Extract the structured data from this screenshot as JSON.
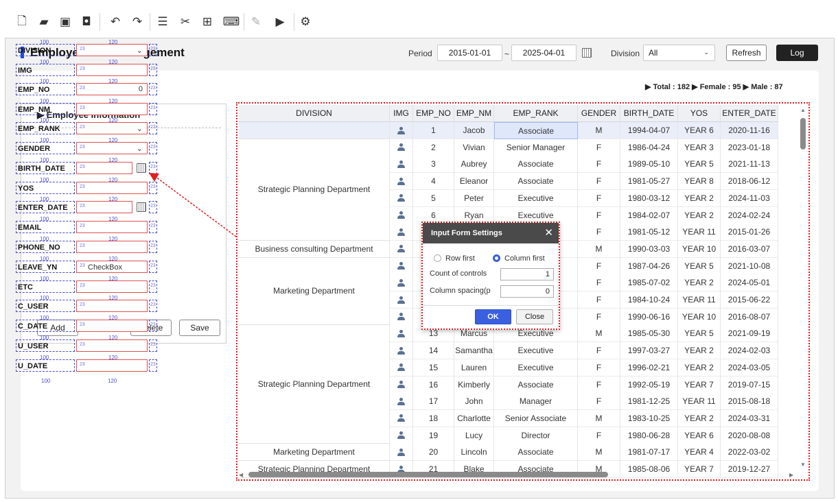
{
  "toolbar": {
    "icons": [
      "new-file",
      "open-folder",
      "save",
      "save-all",
      "undo",
      "redo",
      "database",
      "tools",
      "hierarchy",
      "code-view",
      "edit",
      "run",
      "settings"
    ]
  },
  "header": {
    "title": "Employee Info Management",
    "period_label": "Period",
    "date_from": "2015-01-01",
    "tilde": "~",
    "date_to": "2025-04-01",
    "division_label": "Division",
    "division_value": "All",
    "refresh_label": "Refresh",
    "log_label": "Log"
  },
  "stats": {
    "total": "▶ Total : 182",
    "female": "▶ Female : 95",
    "male": "▶ Male : 87"
  },
  "employee_panel": {
    "title": "▶ Employee Information",
    "add_label": "Add",
    "delete_label": "Delete",
    "save_label": "Save"
  },
  "layout_fields": {
    "label_width": "100",
    "control_width": "120",
    "checkbox_text": "CheckBox",
    "zero": "0",
    "glyph": "23",
    "labels": [
      "DIVISION",
      "IMG",
      "EMP_NO",
      "EMP_NM",
      "EMP_RANK",
      "GENDER",
      "BIRTH_DATE",
      "YOS",
      "ENTER_DATE",
      "EMAIL",
      "PHONE_NO",
      "LEAVE_YN",
      "ETC",
      "C_USER",
      "C_DATE",
      "U_USER",
      "U_DATE"
    ]
  },
  "grid": {
    "columns": [
      "DIVISION",
      "IMG",
      "EMP_NO",
      "EMP_NM",
      "EMP_RANK",
      "GENDER",
      "BIRTH_DATE",
      "YOS",
      "ENTER_DATE"
    ],
    "division_groups": [
      {
        "text": "",
        "rows": 1
      },
      {
        "text": "Strategic Planning Department",
        "rows": 6
      },
      {
        "text": "Business consulting Department",
        "rows": 1
      },
      {
        "text": "Marketing Department",
        "rows": 4
      },
      {
        "text": "Strategic Planning Department",
        "rows": 7
      },
      {
        "text": "Marketing Department",
        "rows": 1
      },
      {
        "text": "Strategic Planning Department",
        "rows": 1
      },
      {
        "text": "Marketing Department",
        "rows": 1
      }
    ],
    "rows": [
      {
        "no": "1",
        "nm": "Jacob",
        "rank": "Associate",
        "gender": "M",
        "birth": "1994-04-07",
        "yos": "YEAR 6",
        "enter": "2020-11-16"
      },
      {
        "no": "2",
        "nm": "Vivian",
        "rank": "Senior Manager",
        "gender": "F",
        "birth": "1986-04-24",
        "yos": "YEAR 3",
        "enter": "2023-01-18"
      },
      {
        "no": "3",
        "nm": "Aubrey",
        "rank": "Associate",
        "gender": "F",
        "birth": "1989-05-10",
        "yos": "YEAR 5",
        "enter": "2021-11-13"
      },
      {
        "no": "4",
        "nm": "Eleanor",
        "rank": "Associate",
        "gender": "F",
        "birth": "1981-05-27",
        "yos": "YEAR 8",
        "enter": "2018-06-12"
      },
      {
        "no": "5",
        "nm": "Peter",
        "rank": "Executive",
        "gender": "F",
        "birth": "1980-03-12",
        "yos": "YEAR 2",
        "enter": "2024-11-03"
      },
      {
        "no": "6",
        "nm": "Ryan",
        "rank": "Executive",
        "gender": "F",
        "birth": "1984-02-07",
        "yos": "YEAR 2",
        "enter": "2024-02-24"
      },
      {
        "no": "7",
        "nm": "",
        "rank": "",
        "gender": "F",
        "birth": "1981-05-12",
        "yos": "YEAR 11",
        "enter": "2015-01-26"
      },
      {
        "no": "8",
        "nm": "",
        "rank": "ager",
        "gender": "M",
        "birth": "1990-03-03",
        "yos": "YEAR 10",
        "enter": "2016-03-07"
      },
      {
        "no": "9",
        "nm": "",
        "rank": "e",
        "gender": "F",
        "birth": "1987-04-26",
        "yos": "YEAR 5",
        "enter": "2021-10-08"
      },
      {
        "no": "10",
        "nm": "",
        "rank": "ciate",
        "gender": "F",
        "birth": "1985-07-02",
        "yos": "YEAR 2",
        "enter": "2024-05-01"
      },
      {
        "no": "11",
        "nm": "",
        "rank": "e",
        "gender": "F",
        "birth": "1984-10-24",
        "yos": "YEAR 11",
        "enter": "2015-06-22"
      },
      {
        "no": "12",
        "nm": "",
        "rank": "ager",
        "gender": "F",
        "birth": "1990-06-16",
        "yos": "YEAR 10",
        "enter": "2016-08-07"
      },
      {
        "no": "13",
        "nm": "Marcus",
        "rank": "Executive",
        "gender": "M",
        "birth": "1985-05-30",
        "yos": "YEAR 5",
        "enter": "2021-09-19"
      },
      {
        "no": "14",
        "nm": "Samantha",
        "rank": "Executive",
        "gender": "F",
        "birth": "1997-03-27",
        "yos": "YEAR 2",
        "enter": "2024-02-03"
      },
      {
        "no": "15",
        "nm": "Lauren",
        "rank": "Executive",
        "gender": "F",
        "birth": "1996-02-21",
        "yos": "YEAR 2",
        "enter": "2024-03-05"
      },
      {
        "no": "16",
        "nm": "Kimberly",
        "rank": "Associate",
        "gender": "F",
        "birth": "1992-05-19",
        "yos": "YEAR 7",
        "enter": "2019-07-15"
      },
      {
        "no": "17",
        "nm": "John",
        "rank": "Manager",
        "gender": "F",
        "birth": "1981-12-25",
        "yos": "YEAR 11",
        "enter": "2015-08-18"
      },
      {
        "no": "18",
        "nm": "Charlotte",
        "rank": "Senior Associate",
        "gender": "M",
        "birth": "1983-10-25",
        "yos": "YEAR 2",
        "enter": "2024-03-31"
      },
      {
        "no": "19",
        "nm": "Lucy",
        "rank": "Director",
        "gender": "F",
        "birth": "1980-06-28",
        "yos": "YEAR 6",
        "enter": "2020-08-08"
      },
      {
        "no": "20",
        "nm": "Lincoln",
        "rank": "Associate",
        "gender": "M",
        "birth": "1981-07-17",
        "yos": "YEAR 4",
        "enter": "2022-03-02"
      },
      {
        "no": "21",
        "nm": "Blake",
        "rank": "Associate",
        "gender": "M",
        "birth": "1985-08-06",
        "yos": "YEAR 7",
        "enter": "2019-12-27"
      }
    ]
  },
  "dialog": {
    "title": "Input Form Settings",
    "close_symbol": "✕",
    "row_first": "Row first",
    "column_first": "Column first",
    "count_label": "Count of controls",
    "count_value": "1",
    "spacing_label": "Column spacing(p",
    "spacing_value": "0",
    "ok_label": "OK",
    "close_label": "Close"
  },
  "colors": {
    "accent": "#3a60e0",
    "title_bar": "#1f4bd8",
    "selection_border": "#e02020",
    "dark_button": "#222222"
  }
}
